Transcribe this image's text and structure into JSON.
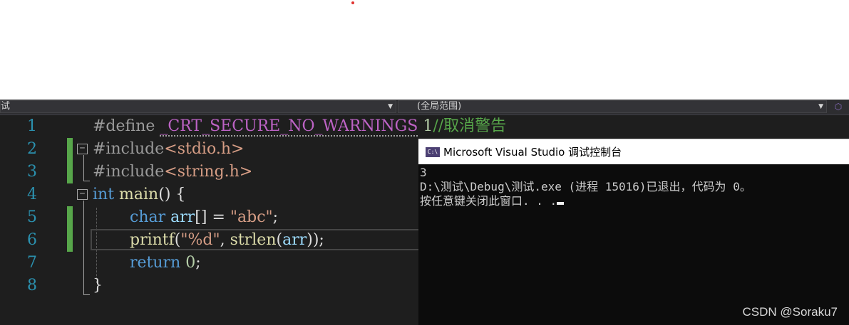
{
  "navbar": {
    "left_combo": "试",
    "right_combo": "(全局范围)"
  },
  "editor": {
    "line_numbers": [
      "1",
      "2",
      "3",
      "4",
      "5",
      "6",
      "7",
      "8"
    ],
    "line1": {
      "directive": "#define",
      "macro": "_CRT_SECURE_NO_WARNINGS",
      "value": "1",
      "comment": "//取消警告"
    },
    "line2": {
      "directive": "#include",
      "header": "<stdio.h>"
    },
    "line3": {
      "directive": "#include",
      "header": "<string.h>"
    },
    "line4": {
      "type": "int",
      "name": "main",
      "rest": "() {"
    },
    "line5": {
      "type": "char",
      "var": "arr",
      "mid": "[] = ",
      "string": "\"abc\"",
      "end": ";"
    },
    "line6": {
      "fn": "printf",
      "open": "(",
      "format": "\"%d\"",
      "sep": ", ",
      "fn2": "strlen",
      "open2": "(",
      "arg": "arr",
      "close": "));"
    },
    "line7": {
      "kw": "return",
      "value": "0",
      "end": ";"
    },
    "line8": {
      "brace": "}"
    }
  },
  "console": {
    "icon": "C:\\",
    "title": "Microsoft Visual Studio 调试控制台",
    "lines": [
      "3",
      "D:\\测试\\Debug\\测试.exe (进程 15016)已退出，代码为 0。",
      "按任意键关闭此窗口. . ."
    ]
  },
  "watermark": "CSDN @Soraku7",
  "colors": {
    "keyword": "#569cd6",
    "string": "#d69d85",
    "comment": "#57a64a",
    "line_number": "#2b91af",
    "change_bar": "#57a64a"
  },
  "icons": [
    "chevron-down-icon",
    "console-app-icon"
  ]
}
